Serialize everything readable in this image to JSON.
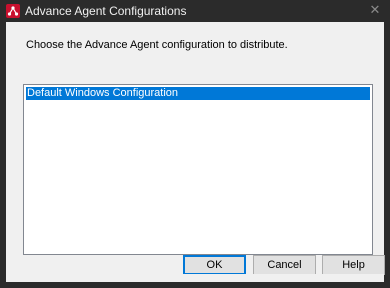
{
  "window": {
    "title": "Advance Agent Configurations",
    "close_glyph": "✕",
    "icon": "app-logo-icon",
    "accent_color": "#c8102e"
  },
  "dialog": {
    "prompt": "Choose the Advance Agent configuration to distribute.",
    "configurations": [
      {
        "label": "Default Windows Configuration",
        "selected": true
      }
    ],
    "selection_color": "#0078d7"
  },
  "buttons": {
    "ok_label": "OK",
    "cancel_label": "Cancel",
    "help_label": "Help"
  }
}
